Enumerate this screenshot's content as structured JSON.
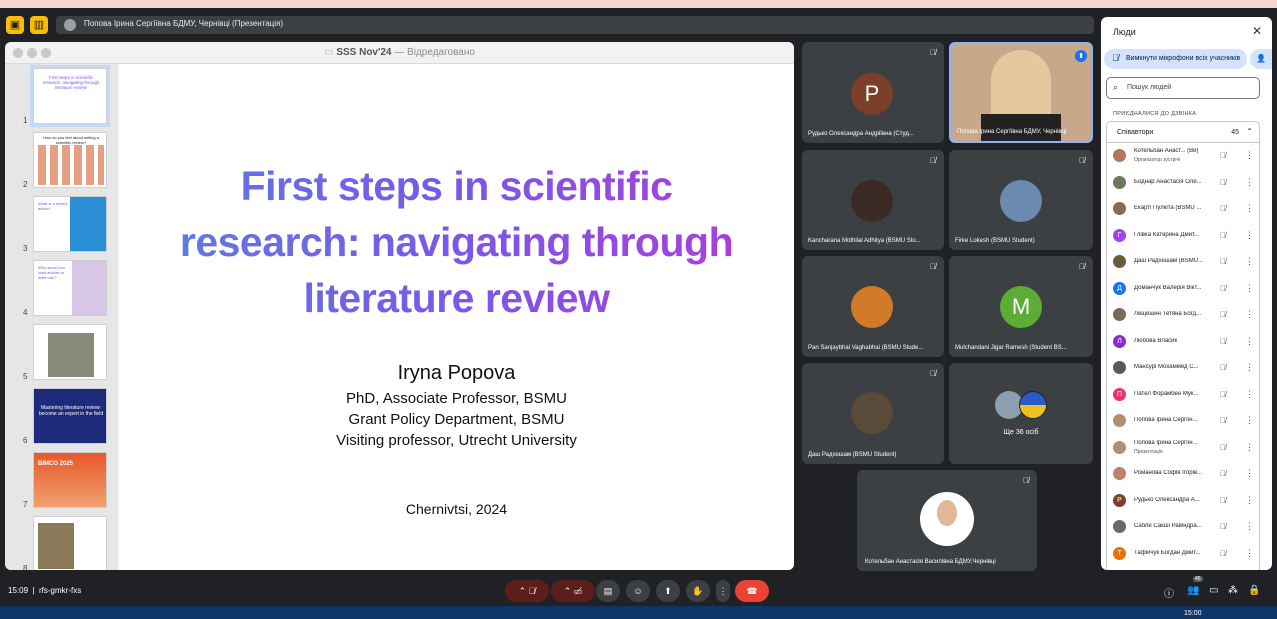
{
  "window": {
    "title": "Попова Ірина Сергіївна БДМУ, Чернівці (Презентація)"
  },
  "keynote": {
    "doc_title": "SSS Nov'24",
    "doc_status": "— Відредаговано"
  },
  "thumbs": [
    {
      "num": "1",
      "text": "First steps in scientific research: navigating through literature review"
    },
    {
      "num": "2",
      "text": "How do you feel about writing a scientific review?"
    },
    {
      "num": "3",
      "text": "What is a review article?"
    },
    {
      "num": "4",
      "text": "Why would you read articles or write one?"
    },
    {
      "num": "5",
      "text": ""
    },
    {
      "num": "6",
      "text": "Mastering literature review: become an expert in the field"
    },
    {
      "num": "7",
      "text": "BIMCO 2025"
    },
    {
      "num": "8",
      "text": ""
    }
  ],
  "slide": {
    "title_lines": [
      "First steps in scientific",
      "research: navigating through",
      "literature review"
    ],
    "author": "Iryna Popova",
    "affiliations": [
      "PhD, Associate Professor, BSMU",
      "Grant Policy Department, BSMU",
      "Visiting professor, Utrecht University"
    ],
    "place": "Chernivtsi, 2024"
  },
  "tiles": [
    {
      "name": "Рудько Олександра Андріївна (Студ...",
      "avatar": "P",
      "color": "#7b3f2a"
    },
    {
      "name": "Попова Ірина Сергіївна БДМУ, Чернівці",
      "avatar": "",
      "color": ""
    },
    {
      "name": "Kancharana Mothilal Adhitya (BSMU Stu...",
      "avatar": "",
      "color": ""
    },
    {
      "name": "Firke Lokesh (BSMU Student)",
      "avatar": "",
      "color": ""
    },
    {
      "name": "Pan Sanjaybhai Vaghabhai (BSMU Stude...",
      "avatar": "",
      "color": ""
    },
    {
      "name": "Mulchandani Jigar Ramesh (Student BS...",
      "avatar": "M",
      "color": "#5cad35"
    },
    {
      "name": "Даш Радхешам (BSMU Student)",
      "avatar": "",
      "color": ""
    },
    {
      "name": "Ще 36 осіб",
      "avatar": "",
      "color": ""
    },
    {
      "name": "Котельбан Анастасія Василівна БДМУ,Чернівці",
      "avatar": "",
      "color": ""
    }
  ],
  "people": {
    "header": "Люди",
    "mute_all": "Вимкнути мікрофони всіх учасників",
    "search_placeholder": "Пошук людей",
    "joined_label": "ПРИЄДНАЛИСЯ ДО ДЗВІНКА",
    "group_label": "Співавтори",
    "group_count": "45",
    "list": [
      {
        "name": "Котельбан Анаст... (Ви)",
        "sub": "Організатор зустрічі",
        "initial": "",
        "color": "#b07a5a"
      },
      {
        "name": "Боднар Анастасія Оле...",
        "sub": "",
        "initial": "",
        "color": "#6b7a5a"
      },
      {
        "name": "Екарті Пулкіта (BSMU ...",
        "sub": "",
        "initial": "",
        "color": "#8a6a50"
      },
      {
        "name": "Глівка Катерина Дмит...",
        "sub": "",
        "initial": "Г",
        "color": "#a142f4"
      },
      {
        "name": "Даш Радхешам (BSMU...",
        "sub": "",
        "initial": "",
        "color": "#6a5a40"
      },
      {
        "name": "Доманчук Валерія Вікт...",
        "sub": "",
        "initial": "Д",
        "color": "#1a73e8"
      },
      {
        "name": "Лещешин Тетяна Богд...",
        "sub": "",
        "initial": "",
        "color": "#7a6a5a"
      },
      {
        "name": "Любова Власик",
        "sub": "",
        "initial": "Л",
        "color": "#8430ce"
      },
      {
        "name": "Мансурі Мохаммед С...",
        "sub": "",
        "initial": "",
        "color": "#5a5a5a"
      },
      {
        "name": "Пател Форамбен Мук...",
        "sub": "",
        "initial": "П",
        "color": "#e8336a"
      },
      {
        "name": "Попова Ірина Сергіїн...",
        "sub": "",
        "initial": "",
        "color": "#b09070"
      },
      {
        "name": "Попова Ірина Сергіїн...",
        "sub": "Презентація",
        "initial": "",
        "color": "#b09070"
      },
      {
        "name": "Романова Софія Ігорів...",
        "sub": "",
        "initial": "",
        "color": "#c08070"
      },
      {
        "name": "Рудько Олександра А...",
        "sub": "",
        "initial": "Р",
        "color": "#7b3f2a"
      },
      {
        "name": "Сабле Сакші Равіндра...",
        "sub": "",
        "initial": "",
        "color": "#6a6a6a"
      },
      {
        "name": "Тафійчук Богдан Дмит...",
        "sub": "",
        "initial": "Т",
        "color": "#e8710a"
      }
    ]
  },
  "bottom": {
    "time": "15:09",
    "code": "rfs-gmkr-fxs",
    "people_badge": "45"
  },
  "taskbar": {
    "clock": "15:00"
  }
}
